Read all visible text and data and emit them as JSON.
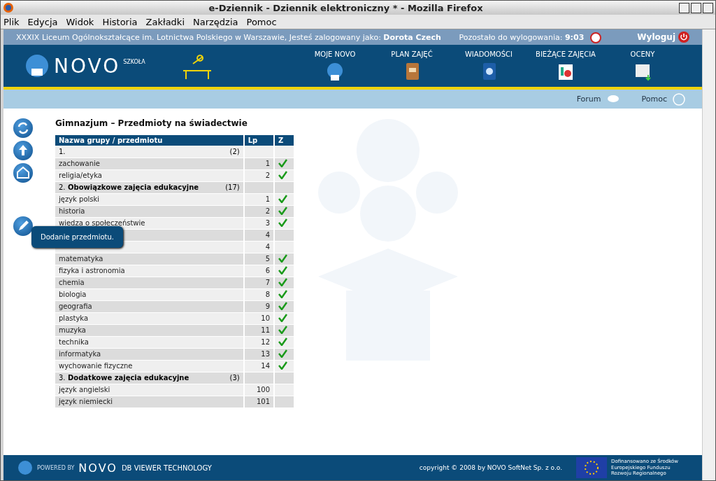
{
  "window": {
    "title": "e-Dziennik - Dziennik elektroniczny * - Mozilla Firefox"
  },
  "menu": [
    "Plik",
    "Edycja",
    "Widok",
    "Historia",
    "Zakładki",
    "Narzędzia",
    "Pomoc"
  ],
  "info_bar": {
    "school": "XXXIX Liceum Ogólnokształcące im. Lotnictwa Polskiego w Warszawie, Jesteś zalogowany jako: **Dorota Czech**",
    "timer": "Pozostało do wylogowania: **9:03**",
    "logout": "Wyloguj"
  },
  "logo": {
    "name": "NOVO",
    "sub": "SZKOŁA"
  },
  "nav": [
    {
      "label": "MOJE NOVO",
      "kind": "globe"
    },
    {
      "label": "PLAN ZAJĘĆ",
      "kind": "notebook"
    },
    {
      "label": "WIADOMOŚCI",
      "kind": "mail"
    },
    {
      "label": "BIEŻĄCE ZAJĘCIA",
      "kind": "charts"
    },
    {
      "label": "OCENY",
      "kind": "grades"
    }
  ],
  "sub_bar": [
    "Forum",
    "Pomoc"
  ],
  "side_tools": [
    {
      "kind": "refresh"
    },
    {
      "kind": "up"
    },
    {
      "kind": "home"
    },
    {
      "kind": "edit"
    }
  ],
  "tooltip": "Dodanie przedmiotu.",
  "page_title": "Gimnazjum – Przedmioty na świadectwie",
  "table": {
    "columns": [
      "Nazwa grupy / przedmiotu",
      "Lp",
      "Z"
    ],
    "rows": [
      {
        "kind": "group",
        "number": "1.",
        "count": "(2)"
      },
      {
        "kind": "subject",
        "name": "zachowanie",
        "lp": "1",
        "checked": true
      },
      {
        "kind": "subject",
        "name": "religia/etyka",
        "lp": "2",
        "checked": true
      },
      {
        "kind": "group",
        "number": "2.",
        "name": "Obowiązkowe zajęcia edukacyjne",
        "count": "(17)"
      },
      {
        "kind": "subject",
        "name": "język polski",
        "lp": "1",
        "checked": true
      },
      {
        "kind": "subject",
        "name": "historia",
        "lp": "2",
        "checked": true
      },
      {
        "kind": "subject",
        "name": "wiedza o społeczeństwie",
        "lp": "3",
        "checked": true
      },
      {
        "kind": "subject",
        "lp": "4",
        "checked": false
      },
      {
        "kind": "subject",
        "lp": "4",
        "checked": false
      },
      {
        "kind": "subject",
        "name": "matematyka",
        "lp": "5",
        "checked": true
      },
      {
        "kind": "subject",
        "name": "fizyka i astronomia",
        "lp": "6",
        "checked": true
      },
      {
        "kind": "subject",
        "name": "chemia",
        "lp": "7",
        "checked": true
      },
      {
        "kind": "subject",
        "name": "biologia",
        "lp": "8",
        "checked": true
      },
      {
        "kind": "subject",
        "name": "geografia",
        "lp": "9",
        "checked": true
      },
      {
        "kind": "subject",
        "name": "plastyka",
        "lp": "10",
        "checked": true
      },
      {
        "kind": "subject",
        "name": "muzyka",
        "lp": "11",
        "checked": true
      },
      {
        "kind": "subject",
        "name": "technika",
        "lp": "12",
        "checked": true
      },
      {
        "kind": "subject",
        "name": "informatyka",
        "lp": "13",
        "checked": true
      },
      {
        "kind": "subject",
        "name": "wychowanie fizyczne",
        "lp": "14",
        "checked": true
      },
      {
        "kind": "group",
        "number": "3.",
        "name": "Dodatkowe zajęcia edukacyjne",
        "count": "(3)"
      },
      {
        "kind": "subject",
        "name": "język angielski",
        "lp": "100",
        "checked": false
      },
      {
        "kind": "subject",
        "name": "język niemiecki",
        "lp": "101",
        "checked": false
      }
    ]
  },
  "footer": {
    "powered": "POWERED BY",
    "brand": "NOVO",
    "tech": "DB VIEWER TECHNOLOGY",
    "copyright": "copyright © 2008 by NOVO SoftNet Sp. z o.o.",
    "eu": "Dofinansowano ze Środków Europejskiego Funduszu Rozwoju Regionalnego"
  }
}
